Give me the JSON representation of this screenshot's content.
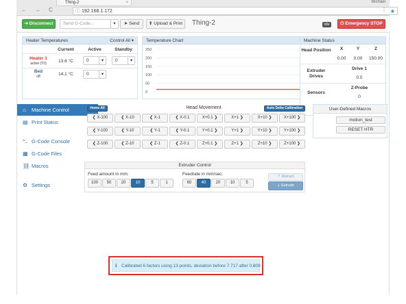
{
  "browser": {
    "tab_title": "Thing-2",
    "tab_close": "×",
    "user": "Michael",
    "back": "←",
    "forward": "→",
    "reload": "C",
    "url_info": "ⓘ",
    "url": "192.168.1.172",
    "star": "★",
    "menu": "⋮"
  },
  "topbar": {
    "disconnect_label": "Disconnect",
    "gcode_placeholder": "Send G-Code...",
    "gcode_dropdown": "▾",
    "send_label": "Send",
    "upload_label": "Upload & Print",
    "title": "Thing-2",
    "status_badge": "Idle",
    "estop_label": "Emergency STOP"
  },
  "heater_panel": {
    "title": "Heater Temperatures",
    "control_all": "Control All ▾",
    "col_current": "Current",
    "col_active": "Active",
    "col_standby": "Standby",
    "heater1_name": "Heater 1",
    "heater1_state": "active (T0)",
    "heater1_current": "13.6 °C",
    "heater1_active": "0",
    "heater1_standby": "0",
    "bed_name": "Bed",
    "bed_state": "off",
    "bed_current": "14.1 °C",
    "bed_active": "0",
    "dropdown": "▾"
  },
  "temp_chart": {
    "title": "Temperature Chart"
  },
  "chart_data": {
    "type": "line",
    "title": "Temperature Chart",
    "y_ticks": [
      "250",
      "200",
      "150",
      "100",
      "50",
      "0"
    ],
    "ylim": [
      0,
      250
    ],
    "series": [
      {
        "values": [
          14,
          14,
          14,
          14,
          14,
          14,
          14,
          14,
          14,
          14,
          14,
          14
        ]
      }
    ],
    "line_color": "#d9534f"
  },
  "machine_status": {
    "title": "Machine Status",
    "head_position_label": "Head Position",
    "col_x": "X",
    "col_y": "Y",
    "col_z": "Z",
    "x": "0.00",
    "y": "0.00",
    "z": "150.00",
    "extruder_drives_label": "Extruder Drives",
    "drive1_label": "Drive 1",
    "drive1_value": "0.0",
    "sensors_label": "Sensors",
    "zprobe_label": "Z-Probe",
    "zprobe_value": "0"
  },
  "sidebar": {
    "items": [
      {
        "label": "Machine Control",
        "icon": "home-icon",
        "glyph": "⌂"
      },
      {
        "label": "Print Status",
        "icon": "print-icon",
        "glyph": "▤"
      },
      {
        "label": "G-Code Console",
        "icon": "console-icon",
        "glyph": ">_"
      },
      {
        "label": "G-Code Files",
        "icon": "files-icon",
        "glyph": "▦"
      },
      {
        "label": "Macros",
        "icon": "link-icon",
        "glyph": "⛓"
      },
      {
        "label": "Settings",
        "icon": "gear-icon",
        "glyph": "⚙"
      }
    ]
  },
  "head_movement": {
    "title": "Head Movement",
    "home_all": "Home All",
    "auto_delta": "Auto Delta Calibration",
    "rows": [
      [
        "❮ X-100",
        "❮ X-10",
        "❮ X-1",
        "❮ X-0.1",
        "X+0.1 ❯",
        "X+1 ❯",
        "X+10 ❯",
        "X+100 ❯"
      ],
      [
        "❮ Y-100",
        "❮ Y-10",
        "❮ Y-1",
        "❮ Y-0.1",
        "Y+0.1 ❯",
        "Y+1 ❯",
        "Y+10 ❯",
        "Y+100 ❯"
      ],
      [
        "❮ Z-100",
        "❮ Z-10",
        "❮ Z-1",
        "❮ Z-0.1",
        "Z+0.1 ❯",
        "Z+1 ❯",
        "Z+10 ❯",
        "Z+100 ❯"
      ]
    ]
  },
  "macros": {
    "title": "User-Defined Macros",
    "items": [
      "motion_test",
      "RESET HTR"
    ]
  },
  "extruder": {
    "title": "Extruder Control",
    "feed_label": "Feed amount in mm:",
    "feed_options": [
      "100",
      "50",
      "20",
      "10",
      "5",
      "1"
    ],
    "feed_selected": "10",
    "rate_label": "Feedrate in mm/sec:",
    "rate_options": [
      "60",
      "40",
      "20",
      "10",
      "5"
    ],
    "rate_selected": "40",
    "retract_label": "⇡ Retract",
    "extrude_label": "⇣ Extrude"
  },
  "toast": {
    "icon": "ℹ",
    "message": "Calibrated 6 factors using 13 points, deviation before 7.717 after 0.009",
    "close": "×"
  }
}
